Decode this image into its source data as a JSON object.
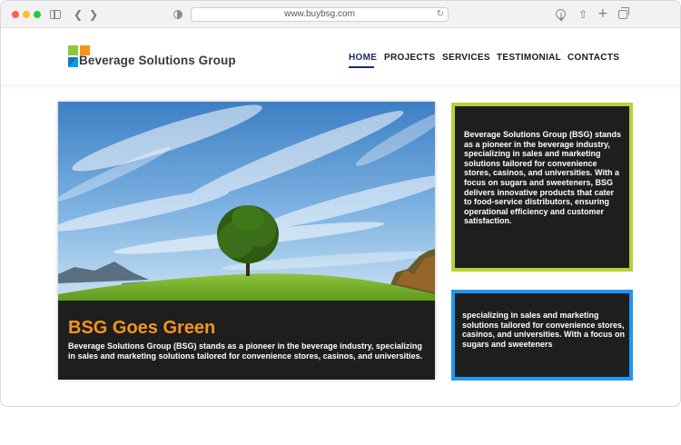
{
  "browser": {
    "url": "www.buybsg.com",
    "icons": [
      "sidebar-icon",
      "back-icon",
      "forward-icon",
      "privacy-icon",
      "reload-icon",
      "download-icon",
      "share-icon",
      "new-tab-icon",
      "tabs-icon"
    ]
  },
  "header": {
    "logo_text": "Beverage Solutions Group",
    "nav": [
      {
        "label": "HOME",
        "active": true
      },
      {
        "label": "PROJECTS",
        "active": false
      },
      {
        "label": "SERVICES",
        "active": false
      },
      {
        "label": "TESTIMONIAL",
        "active": false
      },
      {
        "label": "CONTACTS",
        "active": false
      }
    ],
    "active_color": "#1a2a6c"
  },
  "hero": {
    "title": "BSG Goes Green",
    "body": "Beverage Solutions Group (BSG) stands as a pioneer in the beverage industry, specializing in sales and marketing solutions tailored for convenience stores, casinos, and universities.",
    "title_color": "#f7941d"
  },
  "cards": [
    {
      "text": "Beverage Solutions Group (BSG) stands as a pioneer in the beverage industry, specializing in sales and marketing solutions tailored for convenience stores, casinos, and universities. With a focus on sugars and sweeteners, BSG delivers innovative products that cater to food-service distributors, ensuring operational efficiency and customer satisfaction.",
      "border_color": "#b5d334"
    },
    {
      "text": "specializing in sales and marketing solutions tailored for convenience stores, casinos, and universities. With a focus on sugars and sweeteners",
      "border_color": "#2196f3"
    }
  ]
}
